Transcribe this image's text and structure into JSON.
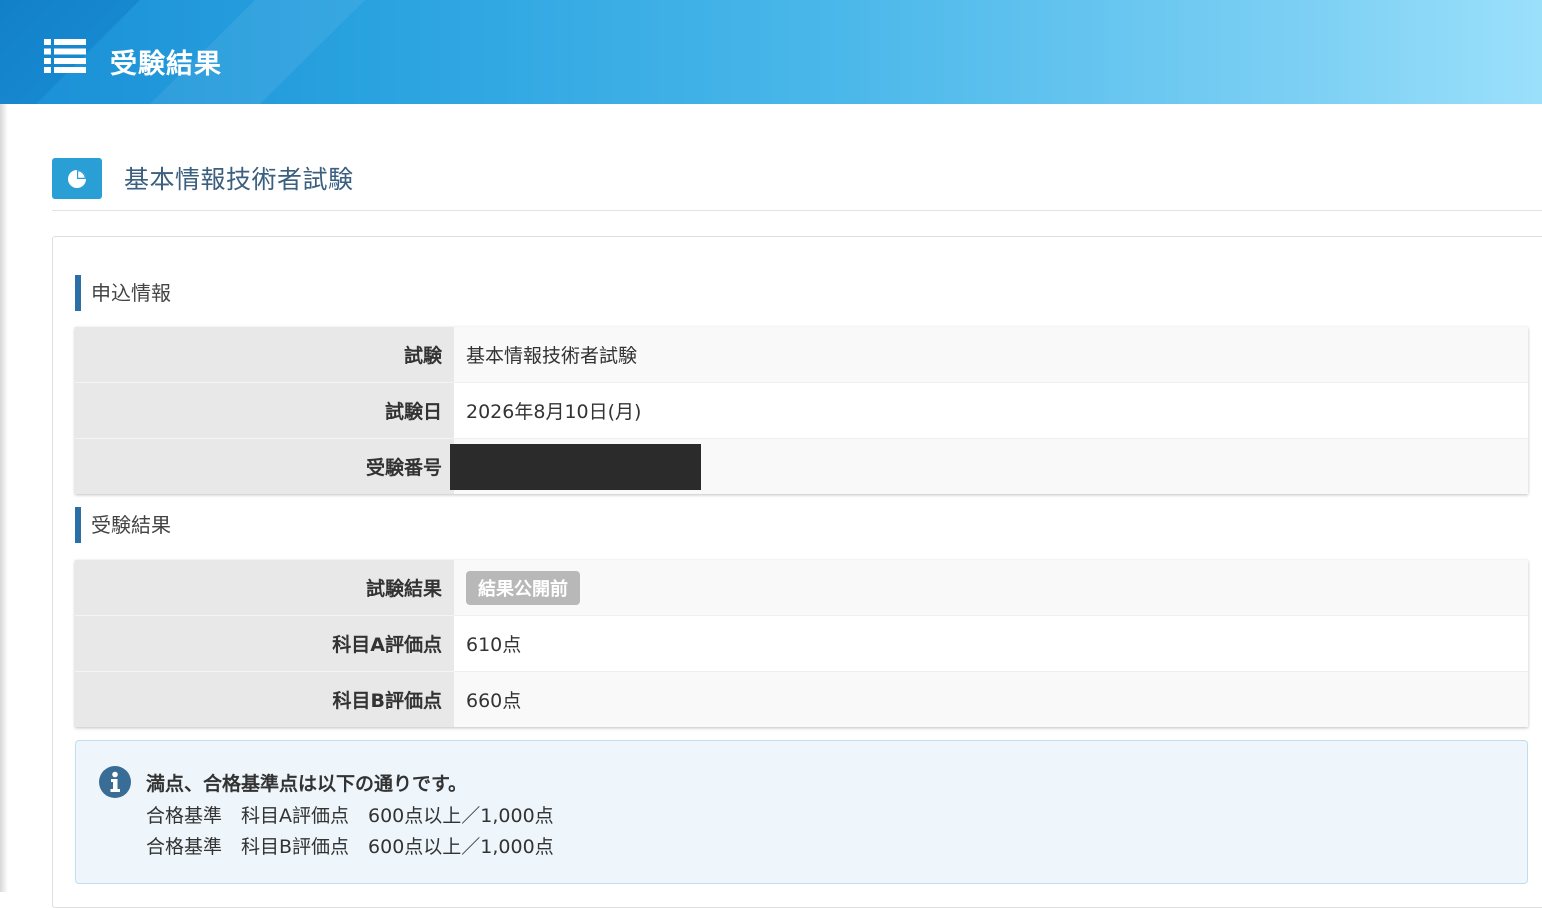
{
  "header": {
    "title": "受験結果",
    "menu_icon": "list-icon"
  },
  "exam_heading": {
    "title": "基本情報技術者試験",
    "icon": "pie-chart-icon"
  },
  "application_info": {
    "section_title": "申込情報",
    "rows": [
      {
        "label": "試験",
        "value": "基本情報技術者試験"
      },
      {
        "label": "試験日",
        "value": "2026年8月10日(月)"
      },
      {
        "label": "受験番号",
        "value": ""
      }
    ]
  },
  "exam_result": {
    "section_title": "受験結果",
    "rows": [
      {
        "label": "試験結果",
        "value": "結果公開前"
      },
      {
        "label": "科目A評価点",
        "value": "610点"
      },
      {
        "label": "科目B評価点",
        "value": "660点"
      }
    ]
  },
  "notice": {
    "icon": "info-icon",
    "lead": "満点、合格基準点は以下の通りです。",
    "lines": [
      "合格基準　科目A評価点　600点以上／1,000点",
      "合格基準　科目B評価点　600点以上／1,000点"
    ]
  },
  "colors": {
    "header_gradient_start": "#1a8fd6",
    "header_gradient_end": "#9be0fb",
    "section_accent": "#2c6ea6",
    "status_badge": "#b8b8b8",
    "notice_bg": "#eef6fb"
  }
}
